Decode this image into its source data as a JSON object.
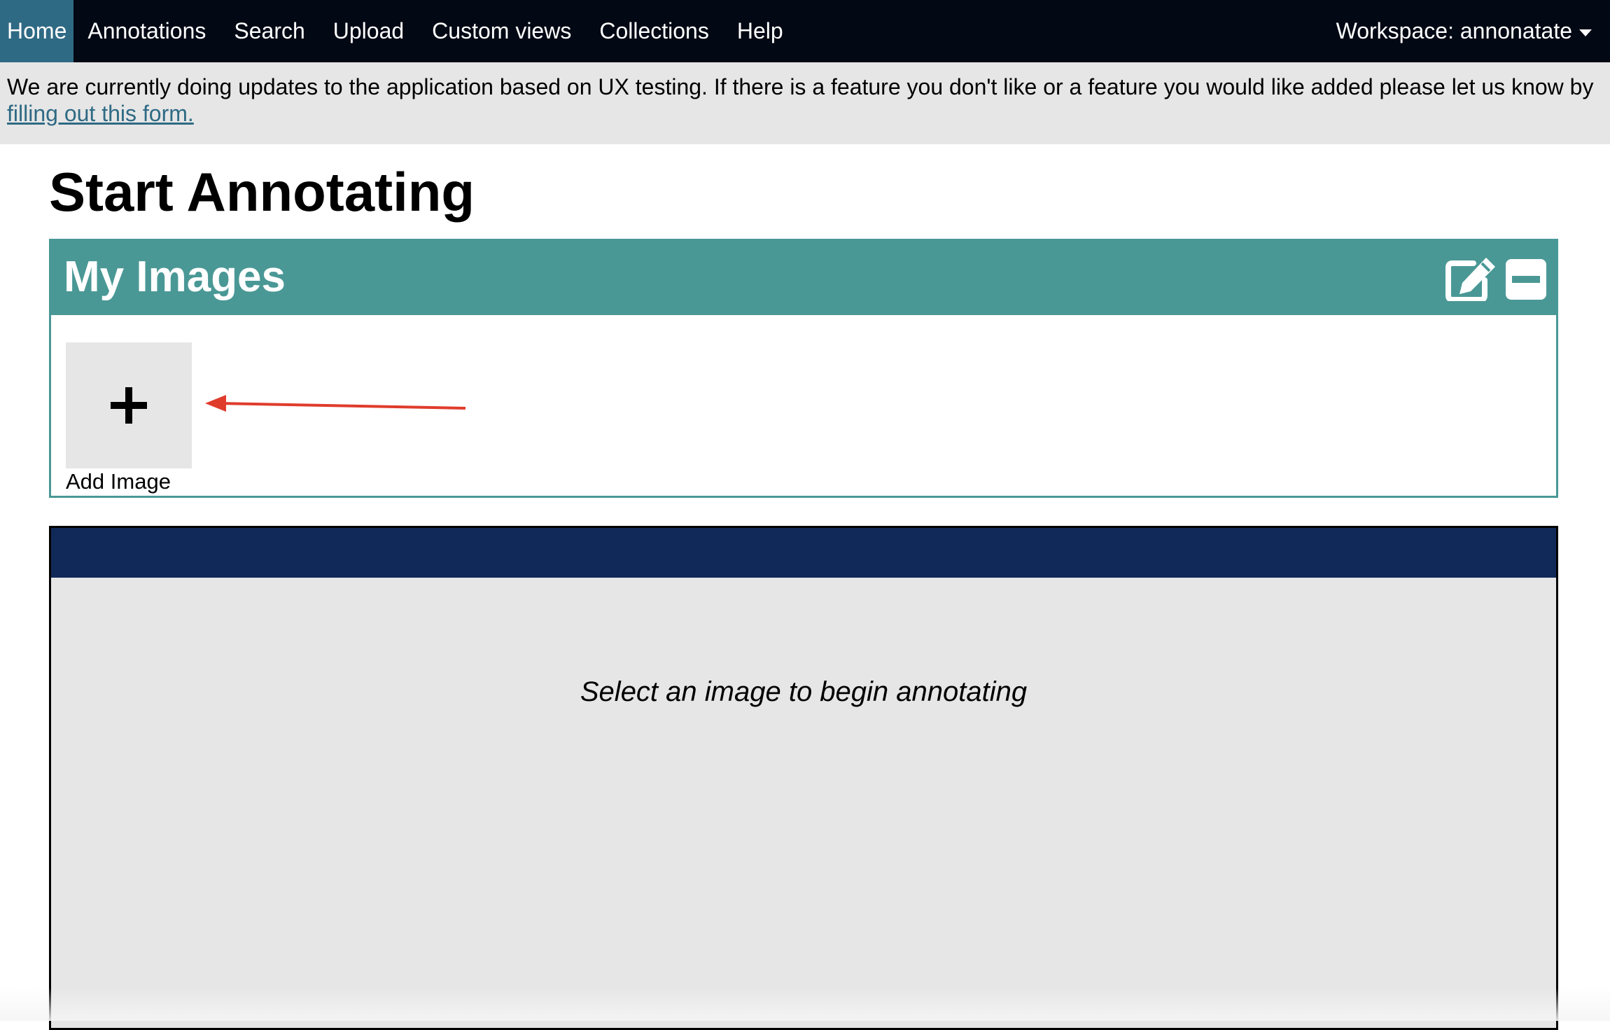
{
  "nav": {
    "items": [
      {
        "label": "Home",
        "active": true
      },
      {
        "label": "Annotations",
        "active": false
      },
      {
        "label": "Search",
        "active": false
      },
      {
        "label": "Upload",
        "active": false
      },
      {
        "label": "Custom views",
        "active": false
      },
      {
        "label": "Collections",
        "active": false
      },
      {
        "label": "Help",
        "active": false
      }
    ],
    "workspace_label": "Workspace: annonatate"
  },
  "notice": {
    "text": "We are currently doing updates to the application based on UX testing. If there is a feature you don't like or a feature you would like added please let us know by",
    "link_text": "filling out this form."
  },
  "page_title": "Start Annotating",
  "images_panel": {
    "title": "My Images",
    "edit_icon": "edit-icon",
    "collapse_icon": "minus-square-icon",
    "add_tile_icon": "plus-icon",
    "add_label": "Add Image",
    "header_color": "#4a9896"
  },
  "viewer": {
    "header_color": "#112958",
    "message": "Select an image to begin annotating"
  },
  "colors": {
    "nav_bg": "#020814",
    "nav_active": "#2f6a84",
    "link": "#2f6a84",
    "annotation_arrow": "#e03c2c"
  }
}
